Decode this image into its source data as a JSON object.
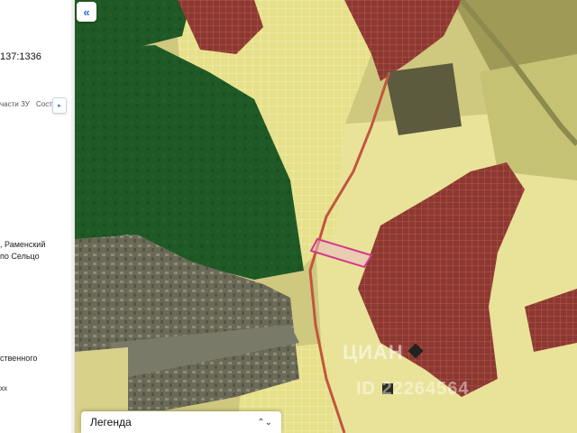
{
  "panel": {
    "cadastral_fragment": "137:1336",
    "tab_parts": "части ЗУ",
    "tab_composition": "Сост",
    "address_line1": ", Раменский",
    "address_line2": "по Сельцо",
    "ownership_fragment": "ственного",
    "misc_fragment": "хх",
    "scroll_icon": "caret-right-icon"
  },
  "map": {
    "collapse_icon": "double-chevron-left-icon",
    "collapse_label": "«",
    "legend_label": "Легенда",
    "legend_icon": "up-down-chevron-icon",
    "legend_chevron": "⌃⌄",
    "watermark_line1": "ЦИАН",
    "watermark_line2": "ID 22264564",
    "colors": {
      "forest": "#1f5a26",
      "parcel_fill": "#e6e08a",
      "parcel_border": "#f1ec9e",
      "urban": "#8a3a33",
      "road": "#c2553f",
      "highlight": "#d23a8a"
    }
  }
}
